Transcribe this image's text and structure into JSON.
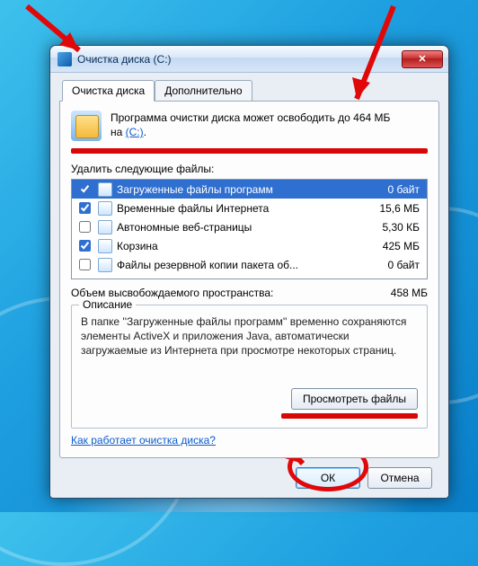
{
  "window": {
    "title": "Очистка диска  (C:)",
    "close_label": "✕"
  },
  "tabs": {
    "main": "Очистка диска",
    "extra": "Дополнительно"
  },
  "info": {
    "line1": "Программа очистки диска может освободить до 464 МБ",
    "line2_prefix": "на ",
    "line2_link": "(C:)",
    "line2_suffix": "."
  },
  "delete_label": "Удалить следующие файлы:",
  "files": [
    {
      "name": "Загруженные файлы программ",
      "size": "0 байт",
      "checked": true,
      "selected": true
    },
    {
      "name": "Временные файлы Интернета",
      "size": "15,6 МБ",
      "checked": true,
      "selected": false
    },
    {
      "name": "Автономные веб-страницы",
      "size": "5,30 КБ",
      "checked": false,
      "selected": false
    },
    {
      "name": "Корзина",
      "size": "425 МБ",
      "checked": true,
      "selected": false
    },
    {
      "name": "Файлы резервной копии пакета об...",
      "size": "0 байт",
      "checked": false,
      "selected": false
    }
  ],
  "total": {
    "label": "Объем высвобождаемого пространства:",
    "value": "458 МБ"
  },
  "group_label": "Описание",
  "description": "В папке ''Загруженные файлы программ'' временно сохраняются элементы ActiveX и приложения Java, автоматически загружаемые из Интернета при просмотре некоторых страниц.",
  "view_files_btn": "Просмотреть файлы",
  "help_link": "Как работает очистка диска?",
  "ok_btn": "ОК",
  "cancel_btn": "Отмена"
}
